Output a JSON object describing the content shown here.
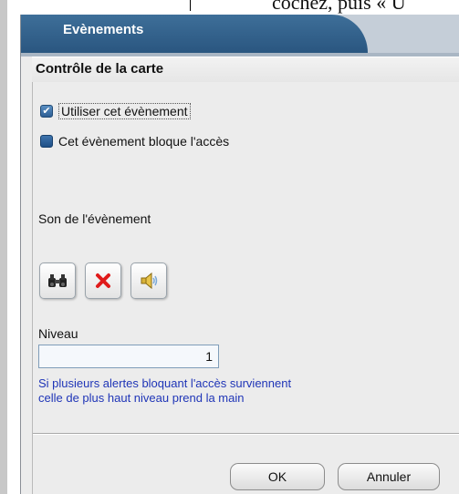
{
  "background": {
    "doc_text": "cochez, puis « U"
  },
  "window": {
    "title": "Evènements",
    "header": "Contrôle de la carte"
  },
  "options": {
    "use_event": {
      "label": "Utiliser cet évènement",
      "checked": true
    },
    "blocks_access": {
      "label": "Cet évènement bloque l'accès",
      "checked": false
    }
  },
  "sound": {
    "label": "Son de l'évènement",
    "buttons": [
      {
        "icon": "binoculars-icon"
      },
      {
        "icon": "delete-icon"
      },
      {
        "icon": "speaker-icon"
      }
    ]
  },
  "level": {
    "label": "Niveau",
    "value": "1"
  },
  "info": {
    "line1": "Si plusieurs alertes bloquant l'accès surviennent",
    "line2": "celle de plus haut niveau prend la main"
  },
  "footer": {
    "ok_label": "OK",
    "cancel_label": "Annuler"
  },
  "colors": {
    "title_bar": "#2a5680",
    "info_text": "#1f35b7",
    "checkbox": "#2e5f94"
  }
}
